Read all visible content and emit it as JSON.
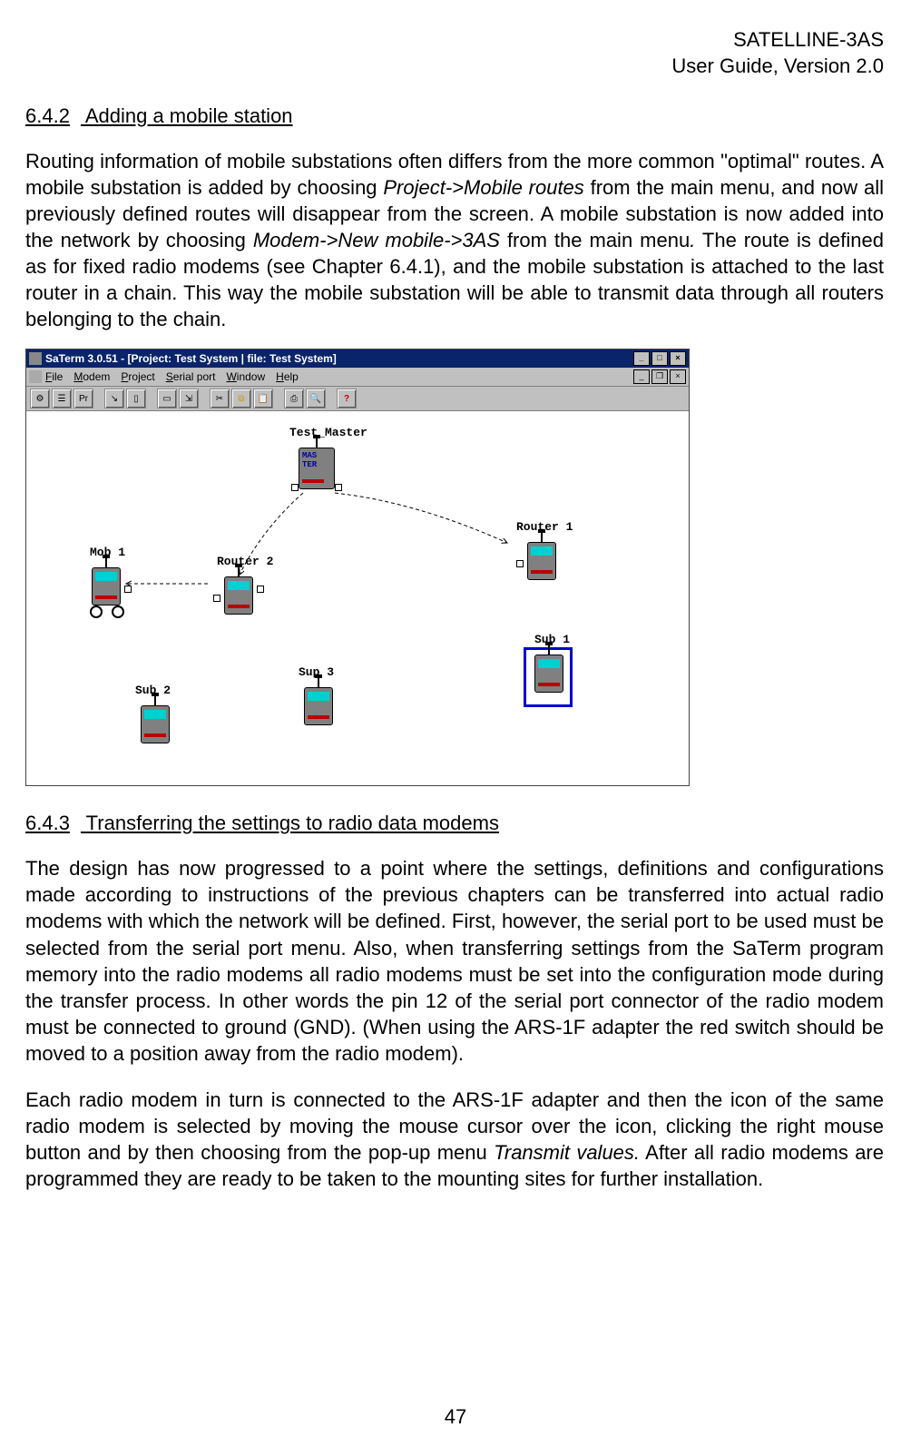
{
  "header": {
    "line1": "SATELLINE-3AS",
    "line2": "User Guide, Version 2.0"
  },
  "section_642": {
    "number": "6.4.2",
    "title": "Adding a mobile station",
    "para1_pre": "Routing information of mobile substations often differs from the more common \"optimal\" routes. A mobile substation is added by choosing ",
    "para1_i1": "Project->Mobile routes",
    "para1_mid1": " from the main menu, and now all previously defined routes will disappear from the screen. A mobile substation is now added into the network by choosing ",
    "para1_i2": "Modem->New mobile->3AS",
    "para1_mid2": " from the main menu",
    "para1_i3": ".",
    "para1_post": " The route is defined as for fixed radio modems (see Chapter 6.4.1), and the mobile substation is attached to the last router in a chain. This way the mobile substation will be able to transmit data through all routers belonging to the chain."
  },
  "screenshot": {
    "title": "SaTerm 3.0.51 - [Project: Test System | file: Test System]",
    "menus": [
      "File",
      "Modem",
      "Project",
      "Serial port",
      "Window",
      "Help"
    ],
    "toolbar_pr": "Pr",
    "help_q": "?",
    "nodes": {
      "test_master": "Test_Master",
      "mas": "MAS",
      "ter": "TER",
      "mob1": "Mob 1",
      "router1": "Router 1",
      "router2": "Router 2",
      "sub1": "Sub 1",
      "sub2": "Sub 2",
      "sup3": "Sup 3"
    }
  },
  "section_643": {
    "number": "6.4.3",
    "title": "Transferring the settings to radio data modems",
    "para1": "The design has now progressed to a point where the settings, definitions and configurations made according to instructions of the previous chapters can be transferred into actual radio modems with which the network will be defined. First, however, the serial port to be used must be selected from the serial port menu. Also, when transferring settings from the SaTerm program memory into the radio modems all radio modems must be set into the configuration mode during the transfer process. In other words the pin 12 of the serial port connector of the radio modem must be connected to ground (GND). (When using the ARS-1F adapter the red switch should be moved to a position away from the radio modem).",
    "para2_pre": "Each radio modem in turn is connected to the ARS-1F adapter and then the icon of the same radio modem is selected by moving the mouse cursor over the icon, clicking the right mouse button and by then choosing from the pop-up menu ",
    "para2_i": "Transmit values.",
    "para2_post": " After all radio modems are programmed they are ready to be taken to the mounting sites for further installation."
  },
  "page_number": "47"
}
